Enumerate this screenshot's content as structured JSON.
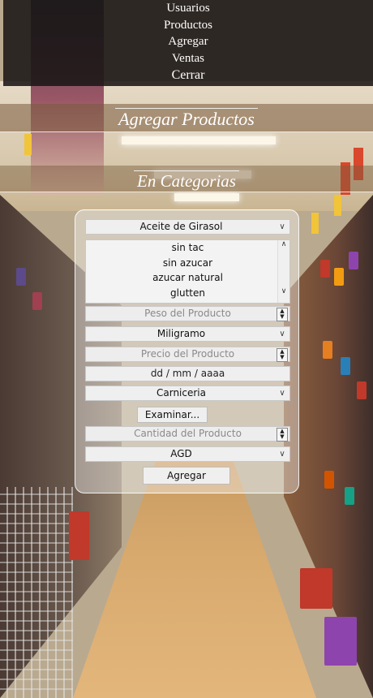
{
  "nav": {
    "items": [
      "Usuarios",
      "Productos",
      "Agregar",
      "Ventas",
      "Cerrar"
    ]
  },
  "headings": {
    "add_products": "Agregar Productos",
    "in_categories": "En Categorias"
  },
  "form": {
    "product_select": "Aceite de Girasol",
    "tags_list": [
      "sin tac",
      "sin azucar",
      "azucar natural",
      "glutten"
    ],
    "weight_placeholder": "Peso del Producto",
    "unit_select": "Miligramo",
    "price_placeholder": "Precio del Producto",
    "date_placeholder": "dd / mm / aaaa",
    "category_select": "Carniceria",
    "browse_button": "Examinar...",
    "quantity_placeholder": "Cantidad del Producto",
    "currency_select": "AGD",
    "submit_button": "Agregar"
  },
  "icons": {
    "dropdown": "chevron-down-icon",
    "spinner": "spin-arrows-icon",
    "scroll": "scroll-arrows-icon"
  },
  "colors": {
    "menu_bg": "#1a1616",
    "heading_text": "#ffffff",
    "control_bg": "#efefef"
  }
}
